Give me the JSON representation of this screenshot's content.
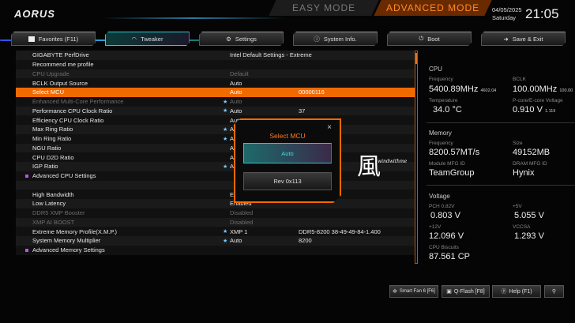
{
  "header": {
    "logo": "AORUS",
    "easy_mode": "EASY MODE",
    "advanced_mode": "ADVANCED MODE",
    "date": "04/05/2025",
    "day": "Saturday",
    "time": "21:05"
  },
  "tabs": [
    {
      "label": "Favorites (F11)",
      "icon": "star-box-icon"
    },
    {
      "label": "Tweaker",
      "icon": "speedometer-icon"
    },
    {
      "label": "Settings",
      "icon": "gear-icon"
    },
    {
      "label": "System Info.",
      "icon": "info-icon"
    },
    {
      "label": "Boot",
      "icon": "power-icon"
    },
    {
      "label": "Save & Exit",
      "icon": "exit-icon"
    }
  ],
  "rows": [
    {
      "name": "GIGABYTE PerfDrive",
      "value": "Intel Default Settings - Extreme",
      "extra": ""
    },
    {
      "name": "Recommend me profile",
      "value": "",
      "extra": ""
    },
    {
      "name": "CPU Upgrade",
      "value": "Default",
      "extra": "",
      "dim": true
    },
    {
      "name": "BCLK Output Source",
      "value": "Auto",
      "extra": ""
    },
    {
      "name": "Select MCU",
      "value": "Auto",
      "extra": "00000116",
      "selected": true
    },
    {
      "name": "Enhanced Multi-Core Performance",
      "value": "Auto",
      "extra": "",
      "dim": true,
      "star": true
    },
    {
      "name": "Performance CPU Clock Ratio",
      "value": "Auto",
      "extra": "37",
      "star": true
    },
    {
      "name": "Efficiency CPU Clock Ratio",
      "value": "Auto",
      "extra": ""
    },
    {
      "name": "Max Ring Ratio",
      "value": "Auto",
      "extra": "",
      "star": true
    },
    {
      "name": "Min Ring Ratio",
      "value": "Auto",
      "extra": "",
      "star": true
    },
    {
      "name": "NGU Ratio",
      "value": "Auto",
      "extra": ""
    },
    {
      "name": "CPU D2D Ratio",
      "value": "Auto",
      "extra": ""
    },
    {
      "name": "IGP Ratio",
      "value": "Auto",
      "extra": "",
      "star": true
    },
    {
      "name": "Advanced CPU Settings",
      "value": "",
      "extra": "",
      "bullet": true
    },
    {
      "name": "",
      "value": "",
      "extra": ""
    },
    {
      "name": "High Bandwidth",
      "value": "Enabled",
      "extra": ""
    },
    {
      "name": "Low Latency",
      "value": "Enabled",
      "extra": ""
    },
    {
      "name": "DDR5 XMP Booster",
      "value": "Disabled",
      "extra": "",
      "dim": true
    },
    {
      "name": "XMP AI BOOST",
      "value": "Disabled",
      "extra": "",
      "dim": true
    },
    {
      "name": "Extreme Memory Profile(X.M.P.)",
      "value": "XMP 1",
      "extra": "DDR5-8200 38-49-49-84-1.400",
      "star": true
    },
    {
      "name": "System Memory Multiplier",
      "value": "Auto",
      "extra": "8200",
      "star": true
    },
    {
      "name": "Advanced Memory Settings",
      "value": "",
      "extra": "",
      "bullet": true
    }
  ],
  "popup": {
    "title": "Select MCU",
    "close": "×",
    "options": [
      "Auto",
      "Rev 0x113"
    ]
  },
  "watermark": {
    "glyph": "風",
    "text": "windwithme"
  },
  "side": {
    "cpu": {
      "title": "CPU",
      "freq_label": "Frequency",
      "freq": "5400.89MHz",
      "freq_sub": "4602.04",
      "bclk_label": "BCLK",
      "bclk": "100.00MHz",
      "bclk_sub": "100.00",
      "temp_label": "Temperature",
      "temp": "34.0 °C",
      "volt_label": "P-core/E-core Voltage",
      "volt": "0.910 V",
      "volt_sub": "1.119"
    },
    "memory": {
      "title": "Memory",
      "freq_label": "Frequency",
      "freq": "8200.57MT/s",
      "size_label": "Size",
      "size": "49152MB",
      "mod_label": "Module MFG ID",
      "mod": "TeamGroup",
      "dram_label": "DRAM MFG ID",
      "dram": "Hynix"
    },
    "voltage": {
      "title": "Voltage",
      "pch_label": "PCH 0.82V",
      "pch": "0.803 V",
      "v5_label": "+5V",
      "v5": "5.055 V",
      "v12_label": "+12V",
      "v12": "12.096 V",
      "vccsa_label": "VCCSA",
      "vccsa": "1.293 V",
      "bisc_label": "CPU Biscuits",
      "bisc": "87.561 CP"
    }
  },
  "bottom": {
    "smartfan": "Smart Fan 6 [F6]",
    "qflash": "Q-Flash [F8]",
    "help": "Help (F1)"
  }
}
